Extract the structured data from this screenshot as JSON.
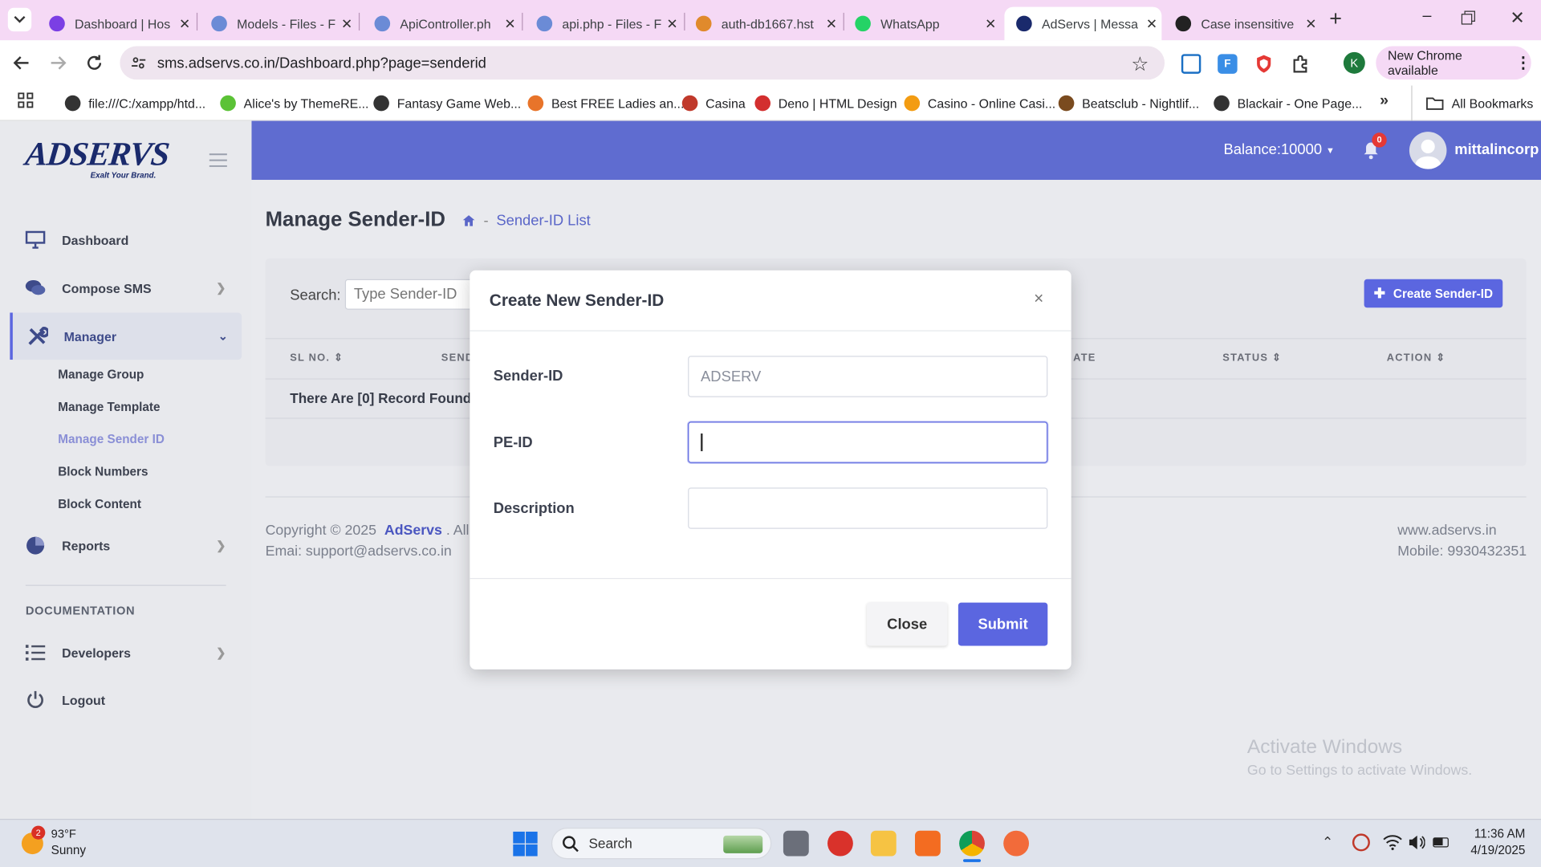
{
  "browser": {
    "tabs": [
      {
        "label": "Dashboard | Hos",
        "icon": "wing-icon",
        "color": "#7b3fe4"
      },
      {
        "label": "Models - Files - F",
        "icon": "globe-icon",
        "color": "#6b8bd6"
      },
      {
        "label": "ApiController.ph",
        "icon": "globe-icon",
        "color": "#6b8bd6"
      },
      {
        "label": "api.php - Files - F",
        "icon": "globe-icon",
        "color": "#6b8bd6"
      },
      {
        "label": "auth-db1667.hst",
        "icon": "pma-icon",
        "color": "#e08a2c"
      },
      {
        "label": "WhatsApp",
        "icon": "whatsapp-icon",
        "color": "#25d366"
      },
      {
        "label": "AdServs | Messa",
        "icon": "adservs-icon",
        "color": "#1a2a6c"
      },
      {
        "label": "Case insensitive",
        "icon": "openai-icon",
        "color": "#222222"
      }
    ],
    "address": "sms.adservs.co.in/Dashboard.php?page=senderid",
    "update_label": "New Chrome available",
    "profile_initial": "K",
    "bookmarks": [
      {
        "label": "file:///C:/xampp/htd...",
        "color": "#333333"
      },
      {
        "label": "Alice's by ThemeRE...",
        "color": "#5bc236"
      },
      {
        "label": "Fantasy Game Web...",
        "color": "#333333"
      },
      {
        "label": "Best FREE Ladies an...",
        "color": "#e8742a"
      },
      {
        "label": "Casina",
        "color": "#c0392b"
      },
      {
        "label": "Deno | HTML Design",
        "color": "#d32f2f"
      },
      {
        "label": "Casino - Online Casi...",
        "color": "#f39c12"
      },
      {
        "label": "Beatsclub - Nightlif...",
        "color": "#7a4b1f"
      },
      {
        "label": "Blackair - One Page...",
        "color": "#333333"
      }
    ],
    "all_bookmarks": "All Bookmarks"
  },
  "app": {
    "logo": "ADSERVS",
    "logo_tagline": "Exalt Your Brand.",
    "balance": "Balance:10000",
    "notif_count": "0",
    "username": "mittalincorp",
    "sidebar": {
      "dashboard": "Dashboard",
      "compose": "Compose SMS",
      "manager": "Manager",
      "sub": [
        "Manage Group",
        "Manage Template",
        "Manage Sender ID",
        "Block Numbers",
        "Block Content"
      ],
      "reports": "Reports",
      "doc_heading": "DOCUMENTATION",
      "developers": "Developers",
      "logout": "Logout"
    },
    "page_title": "Manage Sender-ID",
    "breadcrumb": "Sender-ID List",
    "search_label": "Search:",
    "search_placeholder": "Type Sender-ID",
    "create_button": "Create Sender-ID",
    "table_headers": [
      "SL NO.",
      "SEND",
      "ATE",
      "STATUS",
      "ACTION"
    ],
    "empty_text": "There Are [0] Record Found!",
    "footer": {
      "copyright": "Copyright © 2025",
      "brand": "AdServs",
      "rights": ". All r",
      "email": "Emai: support@adservs.co.in",
      "site": "www.adservs.in",
      "mobile": "Mobile: 9930432351"
    },
    "watermark_title": "Activate Windows",
    "watermark_sub": "Go to Settings to activate Windows."
  },
  "modal": {
    "title": "Create New Sender-ID",
    "fields": [
      {
        "label": "Sender-ID",
        "placeholder": "ADSERV",
        "value": ""
      },
      {
        "label": "PE-ID",
        "placeholder": "",
        "value": ""
      },
      {
        "label": "Description",
        "placeholder": "",
        "value": ""
      }
    ],
    "close_label": "Close",
    "submit_label": "Submit",
    "accent": "#5b66e0"
  },
  "taskbar": {
    "weather_temp": "93°F",
    "weather_desc": "Sunny",
    "weather_badge": "2",
    "search_label": "Search",
    "time": "11:36 AM",
    "date": "4/19/2025"
  }
}
